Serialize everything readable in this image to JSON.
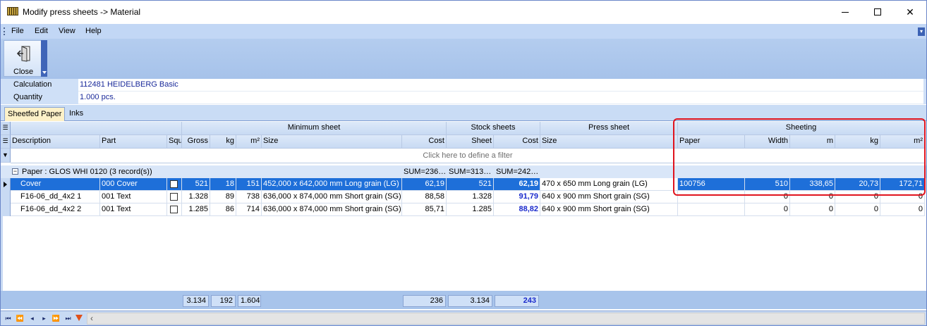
{
  "window": {
    "title": "Modify press sheets -> Material",
    "icon": "app-icon"
  },
  "menu": [
    "File",
    "Edit",
    "View",
    "Help"
  ],
  "toolbar": {
    "close_label": "Close",
    "close_icon": "exit-door-icon"
  },
  "info": {
    "calculation_label": "Calculation",
    "calculation_value": "112481 HEIDELBERG Basic",
    "quantity_label": "Quantity",
    "quantity_value": "1.000 pcs."
  },
  "tabs": [
    {
      "label": "Sheetfed Paper",
      "active": true
    },
    {
      "label": "Inks",
      "active": false
    }
  ],
  "grid": {
    "bands": {
      "minimum_sheet": "Minimum sheet",
      "stock_sheets": "Stock sheets",
      "press_sheet": "Press sheet",
      "sheeting": "Sheeting"
    },
    "columns": {
      "description": "Description",
      "part": "Part",
      "squ": "Squ",
      "gross": "Gross",
      "kg": "kg",
      "m2": "m²",
      "size": "Size",
      "cost": "Cost",
      "sheet": "Sheet",
      "stock_cost": "Cost",
      "press_size": "Size",
      "paper": "Paper",
      "width": "Width",
      "m": "m",
      "sheet_kg": "kg",
      "sheet_m2": "m²"
    },
    "filter_placeholder": "Click here to define a filter",
    "group": {
      "label": "Paper : GLOS WHI 0120  (3 record(s))",
      "sum_cost": "SUM=236…",
      "sum_sheet": "SUM=313…",
      "sum_stock_cost": "SUM=242…"
    },
    "rows": [
      {
        "description": "Cover",
        "part": "000 Cover",
        "gross": "521",
        "kg": "18",
        "m2": "151",
        "size": "452,000 x 642,000 mm Long grain (LG)",
        "cost": "62,19",
        "sheet": "521",
        "stock_cost": "62,19",
        "press_size": "470 x  650 mm Long grain (LG)",
        "paper": "100756",
        "width": "510",
        "m": "338,65",
        "sheet_kg": "20,73",
        "sheet_m2": "172,71"
      },
      {
        "description": "F16-06_dd_4x2 1",
        "part": "001 Text",
        "gross": "1.328",
        "kg": "89",
        "m2": "738",
        "size": "636,000 x 874,000 mm Short grain (SG)",
        "cost": "88,58",
        "sheet": "1.328",
        "stock_cost": "91,79",
        "press_size": "640 x  900 mm Short grain (SG)",
        "paper": "",
        "width": "0",
        "m": "0",
        "sheet_kg": "0",
        "sheet_m2": "0"
      },
      {
        "description": "F16-06_dd_4x2 2",
        "part": "001 Text",
        "gross": "1.285",
        "kg": "86",
        "m2": "714",
        "size": "636,000 x 874,000 mm Short grain (SG)",
        "cost": "85,71",
        "sheet": "1.285",
        "stock_cost": "88,82",
        "press_size": "640 x  900 mm Short grain (SG)",
        "paper": "",
        "width": "0",
        "m": "0",
        "sheet_kg": "0",
        "sheet_m2": "0"
      }
    ]
  },
  "totals": {
    "gross": "3.134",
    "kg": "192",
    "m2": "1.604",
    "cost": "236",
    "sheet": "3.134",
    "stock_cost": "243"
  },
  "colors": {
    "selection": "#1e6fd9",
    "header": "#c8daf3",
    "highlight": "#e0141e",
    "emphasis": "#1a2acc"
  }
}
